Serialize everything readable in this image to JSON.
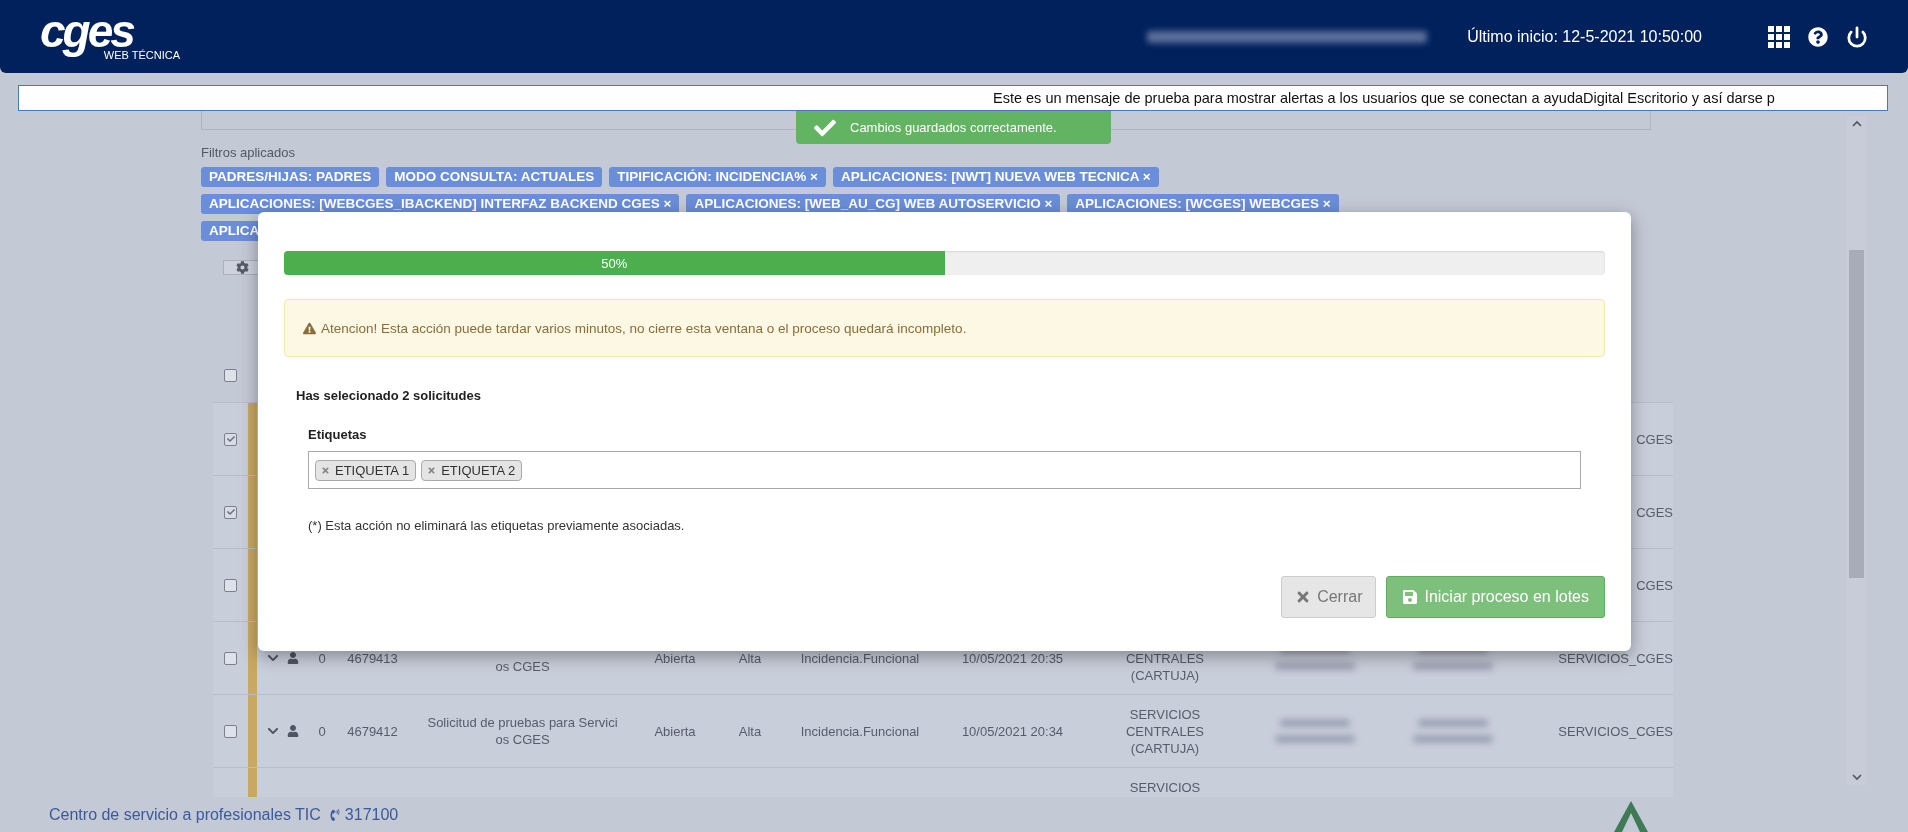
{
  "header": {
    "logo": "cges",
    "logo_subtitle": "WEB TÉCNICA",
    "last_login": "Último inicio: 12-5-2021 10:50:00"
  },
  "alert_banner": {
    "text": "Este es un mensaje de prueba para mostrar alertas a los usuarios que se conectan a ayudaDigital Escritorio y así darse p"
  },
  "toast": {
    "text": "Cambios guardados correctamente."
  },
  "filters": {
    "title": "Filtros aplicados",
    "rows": [
      {
        "tags": [
          "PADRES/HIJAS: PADRES",
          "MODO CONSULTA: ACTUALES",
          "TIPIFICACIÓN: INCIDENCIA% ×",
          "APLICACIONES: [NWT] NUEVA WEB TECNICA ×"
        ]
      },
      {
        "tags": [
          "APLICACIONES: [WEBCGES_IBACKEND] INTERFAZ BACKEND CGES ×",
          "APLICACIONES: [WEB_AU_CG] WEB AUTOSERVICIO ×",
          "APLICACIONES: [WCGES] WEBCGES ×"
        ]
      },
      {
        "tags": [
          "APLICA"
        ]
      }
    ]
  },
  "table": {
    "header_checked": false,
    "rows": [
      {
        "kind": "covered",
        "checked": true,
        "last": "CGES"
      },
      {
        "kind": "covered",
        "checked": true,
        "last": "CGES"
      },
      {
        "kind": "covered",
        "checked": false,
        "last": "CGES"
      },
      {
        "kind": "full",
        "first_line_hidden": true,
        "checked": false,
        "count": "0",
        "id": "4679413",
        "description": [
          "os CGES"
        ],
        "status": "Abierta",
        "priority": "Alta",
        "type": "Incidencia.Funcional",
        "date": "10/05/2021 20:35",
        "centre": [
          "CENTRALES",
          "(CARTUJA)"
        ],
        "last": "SERVICIOS_CGES"
      },
      {
        "kind": "full",
        "first_line_hidden": false,
        "checked": false,
        "count": "0",
        "id": "4679412",
        "description": [
          "Solicitud de pruebas para Servici",
          "os CGES"
        ],
        "status": "Abierta",
        "priority": "Alta",
        "type": "Incidencia.Funcional",
        "date": "10/05/2021 20:34",
        "centre": [
          "SERVICIOS",
          "CENTRALES",
          "(CARTUJA)"
        ],
        "last": "SERVICIOS_CGES"
      },
      {
        "kind": "partial",
        "centre": [
          "SERVICIOS"
        ]
      }
    ]
  },
  "modal": {
    "progress": {
      "level": 0.5,
      "label": "50%"
    },
    "warning": "Atencion! Esta acción puede tardar varios minutos, no cierre esta ventana o el proceso quedará incompleto.",
    "summary": "Has selecionado 2 solicitudes",
    "tags_label": "Etiquetas",
    "tags": [
      "ETIQUETA 1",
      "ETIQUETA 2"
    ],
    "note": "(*) Esta acción no eliminará las etiquetas previamente asociadas.",
    "buttons": [
      {
        "label": "Cerrar",
        "kind": "close"
      },
      {
        "label": "Iniciar proceso en lotes",
        "kind": "submit"
      }
    ]
  },
  "footer": {
    "text": "Centro de servicio a profesionales TIC",
    "phone": "317100"
  }
}
